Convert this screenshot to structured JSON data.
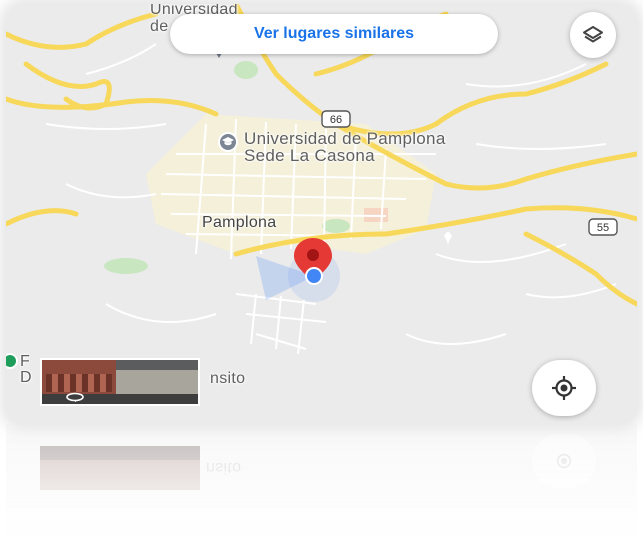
{
  "map": {
    "labels": {
      "universidad_top_line1": "Universidad",
      "universidad_top_line2": "de",
      "univ_pamplona_line1": "Universidad de Pamplona",
      "univ_pamplona_line2": "Sede La Casona",
      "city": "Pamplona",
      "bottom_left_line1": "F",
      "bottom_left_line2": "D",
      "transito_fragment": "nsito",
      "route_66": "66",
      "route_55": "55"
    },
    "colors": {
      "background": "#ebebeb",
      "road_major": "#f7d85a",
      "road_minor": "#ffffff",
      "park": "#c8e6c0",
      "urban_tint": "#fbf3c6",
      "pin": "#e53935",
      "location_dot": "#4285f4",
      "accent": "#1a73e8"
    }
  },
  "toolbar": {
    "similar_places_label": "Ver lugares similares"
  },
  "icons": {
    "layers": "layers-icon",
    "my_location": "my-location-icon",
    "university": "university-icon",
    "place_pin": "map-pin-icon",
    "street_view_rotate": "360-rotate-icon"
  }
}
